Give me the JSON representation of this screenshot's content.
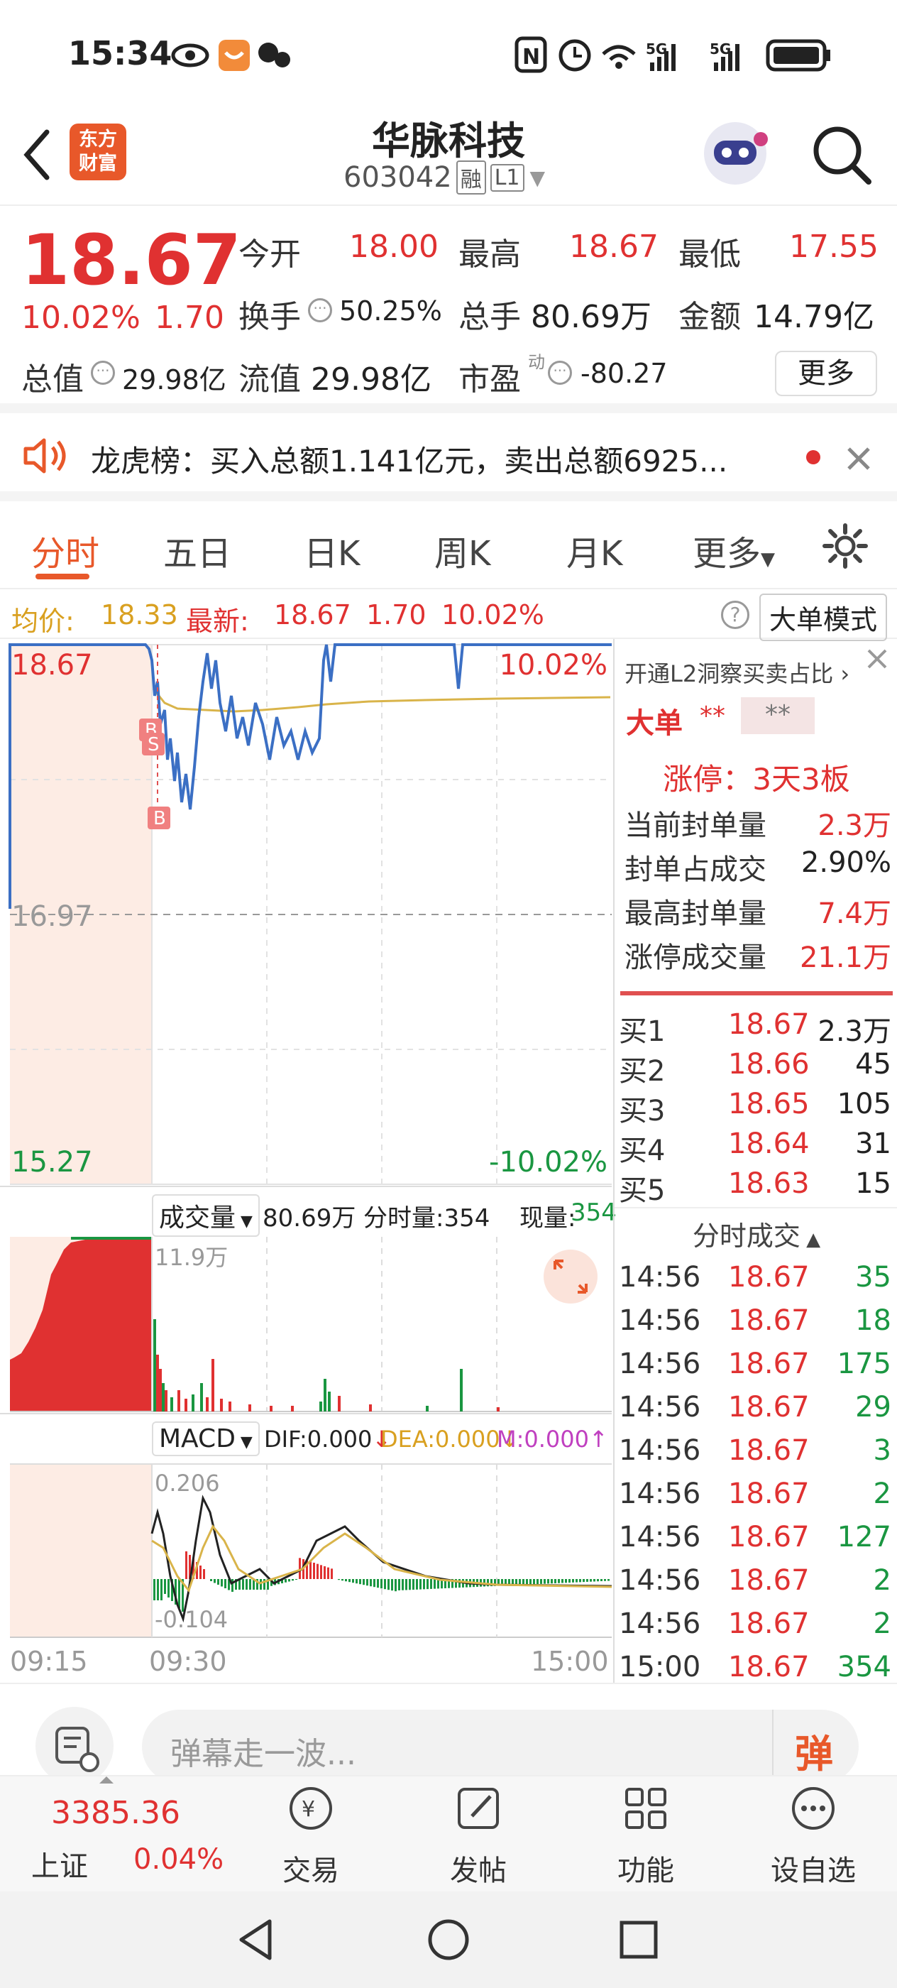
{
  "status_bar": {
    "time": "15:34",
    "signal1": "5G",
    "signal2": "5G"
  },
  "header": {
    "logo_line1": "东方",
    "logo_line2": "财富",
    "stock_name": "华脉科技",
    "stock_code": "603042",
    "badge_margin": "融",
    "badge_level": "L1"
  },
  "quote": {
    "price": "18.67",
    "change_pct": "10.02%",
    "change_amt": "1.70",
    "open_lbl": "今开",
    "open": "18.00",
    "high_lbl": "最高",
    "high": "18.67",
    "low_lbl": "最低",
    "low": "17.55",
    "turnover_lbl": "换手",
    "turnover": "50.25%",
    "volume_lbl": "总手",
    "volume": "80.69万",
    "amount_lbl": "金额",
    "amount": "14.79亿",
    "mktcap_lbl": "总值",
    "mktcap": "29.98亿",
    "float_lbl": "流值",
    "float_cap": "29.98亿",
    "pe_lbl": "市盈",
    "pe_sup": "动",
    "pe": "-80.27",
    "more_label": "更多"
  },
  "notice": {
    "text": "龙虎榜：买入总额1.141亿元，卖出总额6925..."
  },
  "tabs": [
    "分时",
    "五日",
    "日K",
    "周K",
    "月K",
    "更多"
  ],
  "avg_bar": {
    "avg_lbl": "均价:",
    "avg": "18.33",
    "latest_lbl": "最新:",
    "latest": "18.67",
    "chg": "1.70",
    "pct": "10.02%",
    "mode_btn": "大单模式"
  },
  "price_chart": {
    "y_top": "18.67",
    "y_mid": "16.97",
    "y_bot": "15.27",
    "pct_top": "10.02%",
    "pct_bot": "-10.02%",
    "marker_labels": [
      "B",
      "S",
      "B"
    ]
  },
  "volume_panel": {
    "selector": "成交量",
    "total": "80.69万",
    "tick_lbl": "分时量:354",
    "cur_lbl": "现量:",
    "cur": "354",
    "max": "11.9万"
  },
  "macd_panel": {
    "selector": "MACD",
    "dif": "DIF:0.000",
    "dea": "DEA:0.000",
    "m": "M:0.000",
    "top": "0.206",
    "bot": "-0.104"
  },
  "time_axis": {
    "start": "09:15",
    "open": "09:30",
    "end": "15:00"
  },
  "right_panel": {
    "l2_link": "开通L2洞察买卖占比",
    "big_order_lbl": "大单",
    "big_order_val1": "**",
    "big_order_val2": "**",
    "limit_title": "涨停：3天3板",
    "stats": [
      {
        "label": "当前封单量",
        "value": "2.3万"
      },
      {
        "label": "封单占成交",
        "value": "2.90%"
      },
      {
        "label": "最高封单量",
        "value": "7.4万"
      },
      {
        "label": "涨停成交量",
        "value": "21.1万"
      }
    ],
    "bids": [
      {
        "label": "买1",
        "price": "18.67",
        "vol": "2.3万"
      },
      {
        "label": "买2",
        "price": "18.66",
        "vol": "45"
      },
      {
        "label": "买3",
        "price": "18.65",
        "vol": "105"
      },
      {
        "label": "买4",
        "price": "18.64",
        "vol": "31"
      },
      {
        "label": "买5",
        "price": "18.63",
        "vol": "15"
      }
    ],
    "ticks_title": "分时成交",
    "ticks": [
      {
        "t": "14:56",
        "p": "18.67",
        "v": "35"
      },
      {
        "t": "14:56",
        "p": "18.67",
        "v": "18"
      },
      {
        "t": "14:56",
        "p": "18.67",
        "v": "175"
      },
      {
        "t": "14:56",
        "p": "18.67",
        "v": "29"
      },
      {
        "t": "14:56",
        "p": "18.67",
        "v": "3"
      },
      {
        "t": "14:56",
        "p": "18.67",
        "v": "2"
      },
      {
        "t": "14:56",
        "p": "18.67",
        "v": "127"
      },
      {
        "t": "14:56",
        "p": "18.67",
        "v": "2"
      },
      {
        "t": "14:56",
        "p": "18.67",
        "v": "2"
      },
      {
        "t": "15:00",
        "p": "18.67",
        "v": "354"
      }
    ]
  },
  "bottom": {
    "danmu_placeholder": "弹幕走一波...",
    "danmu_btn": "弹"
  },
  "nav": {
    "index_value": "3385.36",
    "index_name": "上证",
    "index_pct": "0.04%",
    "items": [
      "交易",
      "发帖",
      "功能",
      "设自选"
    ]
  },
  "colors": {
    "up": "#e03131",
    "down": "#1a9641",
    "price_line": "#3b6fc4",
    "avg_line": "#d9b44a",
    "accent": "#e8582a"
  }
}
